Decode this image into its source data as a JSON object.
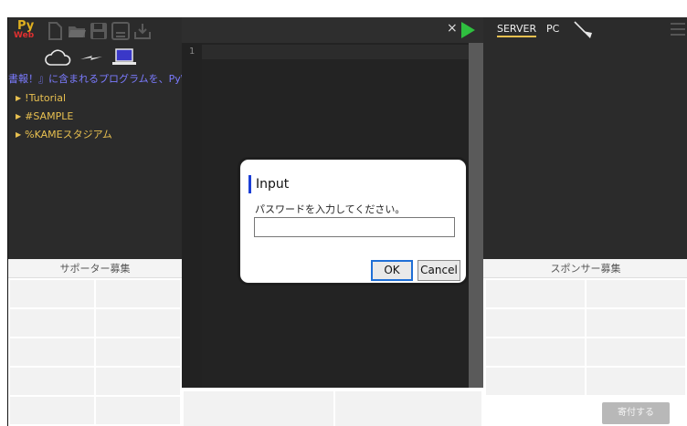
{
  "logo": {
    "line1": "Py",
    "line2": "Web"
  },
  "left_toolbar": {
    "icons": [
      "new-file-icon",
      "open-folder-icon",
      "save-icon",
      "save-as-icon",
      "download-icon"
    ]
  },
  "connection": {
    "icons": [
      "cloud-icon",
      "link-icon",
      "laptop-icon"
    ]
  },
  "info_text": "書報！』に含まれるプログラムを、PyWeb.",
  "tree": {
    "items": [
      {
        "label": "!Tutorial"
      },
      {
        "label": "#SAMPLE"
      },
      {
        "label": "%KAMEスタジアム"
      }
    ]
  },
  "supporter": {
    "title": "サポーター募集"
  },
  "editor": {
    "close_label": "×",
    "line_numbers": [
      "1"
    ]
  },
  "right_panel": {
    "tabs": [
      {
        "label": "SERVER",
        "active": true
      },
      {
        "label": "PC",
        "active": false
      }
    ]
  },
  "sponsor": {
    "title": "スポンサー募集",
    "donate_label": "寄付する"
  },
  "dialog": {
    "title": "Input",
    "message": "パスワードを入力してください。",
    "input_value": "",
    "ok_label": "OK",
    "cancel_label": "Cancel"
  },
  "colors": {
    "accent_yellow": "#e8c050",
    "info_blue": "#7b7bff",
    "run_green": "#2fbf3f",
    "dialog_accent": "#1c3fd6"
  }
}
